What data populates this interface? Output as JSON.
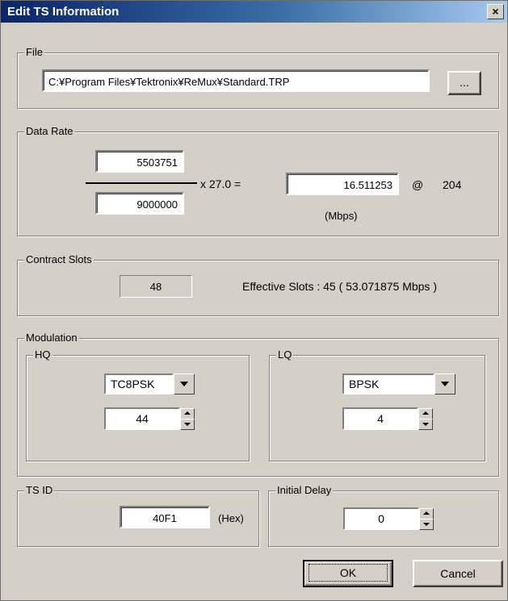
{
  "window": {
    "title": "Edit TS Information",
    "close_glyph": "×"
  },
  "file": {
    "legend": "File",
    "path": "C:¥Program Files¥Tektronix¥ReMux¥Standard.TRP",
    "browse_label": "..."
  },
  "data_rate": {
    "legend": "Data Rate",
    "numerator": "5503751",
    "denominator": "9000000",
    "multiplier": "x  27.0  =",
    "result": "16.511253",
    "at_label": "@",
    "packet_size": "204",
    "unit": "(Mbps)"
  },
  "contract_slots": {
    "legend": "Contract Slots",
    "value": "48",
    "effective": "Effective Slots : 45  ( 53.071875 Mbps )"
  },
  "modulation": {
    "legend": "Modulation",
    "hq": {
      "legend": "HQ",
      "scheme": "TC8PSK",
      "value": "44"
    },
    "lq": {
      "legend": "LQ",
      "scheme": "BPSK",
      "value": "4"
    }
  },
  "ts_id": {
    "legend": "TS ID",
    "value": "40F1",
    "unit": "(Hex)"
  },
  "initial_delay": {
    "legend": "Initial Delay",
    "value": "0"
  },
  "buttons": {
    "ok": "OK",
    "cancel": "Cancel"
  }
}
